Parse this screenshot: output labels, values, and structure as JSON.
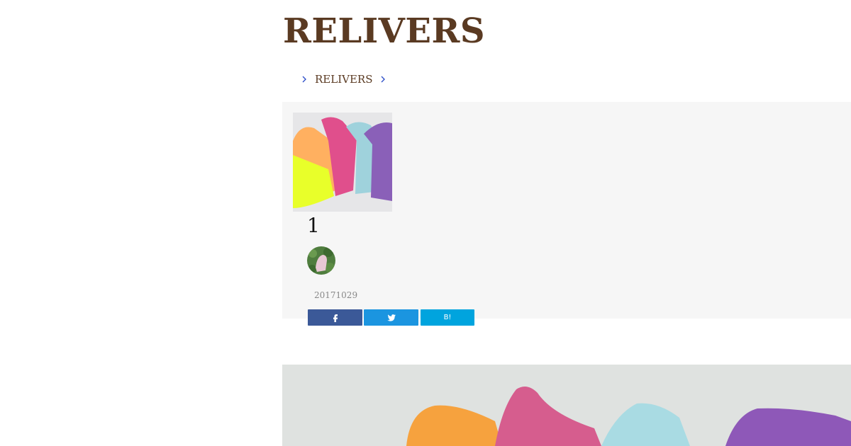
{
  "site": {
    "title": "RELIVERS"
  },
  "breadcrumb": {
    "items": [
      {
        "label": "RELIVERS"
      }
    ]
  },
  "post": {
    "title": "1",
    "date": "20171029",
    "thumbnail": {
      "icon": "colorful-towels-image"
    },
    "author_avatar": {
      "icon": "hand-leaves-avatar"
    }
  },
  "share": {
    "facebook": {
      "icon": "facebook-icon"
    },
    "twitter": {
      "icon": "twitter-icon"
    },
    "hatena": {
      "label": "B!"
    }
  },
  "hero": {
    "icon": "colorful-towels-image"
  },
  "colors": {
    "title": "#5a3a22",
    "breadcrumb_chevron": "#2b4cc8",
    "card_bg": "#f6f6f6",
    "facebook": "#3b5998",
    "twitter": "#1b95e0",
    "hatena": "#00a4de"
  }
}
